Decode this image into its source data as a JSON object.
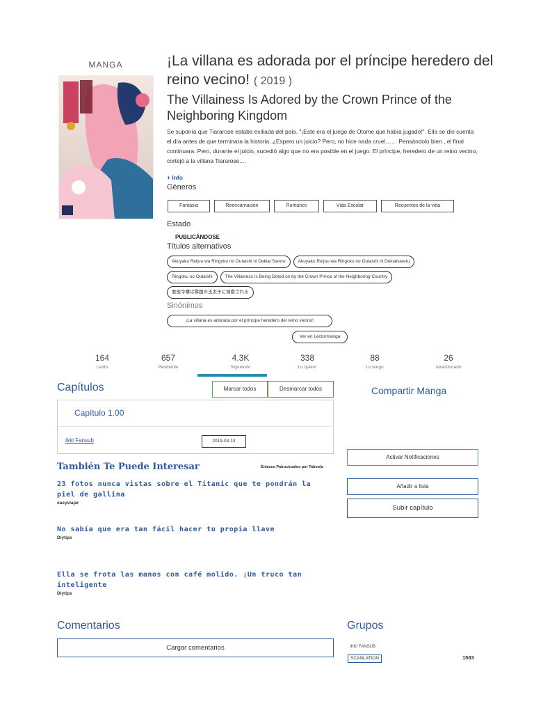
{
  "manga": {
    "type": "MANGA",
    "title": "¡La villana es adorada por el príncipe heredero del reino vecino!",
    "year": "( 2019 )",
    "subtitle": "The Villainess Is Adored by the Crown Prince of the Neighboring Kingdom",
    "synopsis": "Se suponía que Tiararose estaba exiliada del país. \"¡Este era el juego de Otome que había jugado!\". Ella se dio cuenta el día antes de que terminara la historia. ¿Espero un juicio? Pero, no hice nada cruel…… Pensándolo bien , el final continuara. Pero, durante el juicio, sucedió algo que no era posible en el juego. El príncipe, heredero de un reino vecino, cortejó a la villana Tiararose....",
    "more_info": "+ Info",
    "genres_label": "Géneros",
    "genres": [
      "Fantasia",
      "Reencarnación",
      "Romance",
      "Vida Escolar",
      "Recuentos de la vida"
    ],
    "status_label": "Estado",
    "status": "PUBLICÁNDOSE",
    "alt_titles_label": "Títulos alternativos",
    "alt_titles": [
      "Akuyaku Reijou wa Ringoku no Outaishi ni Dekiai Sareru",
      "Akuyaku Reijou wa Ringoku no Outaishi ni Dekiaisareru",
      "Ringoku no Outaishi",
      "The Villainess Is Being Doted on by the Crown Prince of the Neighboring Country",
      "悪役令嬢は隣国の王太子に溺愛される"
    ],
    "synonyms_label": "Sinónimos",
    "synonym": "¡La villana es adorada por el príncipe heredero del reino vecino!",
    "reader_link": "Ver en Lectormanga"
  },
  "stats": [
    {
      "value": "164",
      "label": "Leído"
    },
    {
      "value": "657",
      "label": "Pendiente"
    },
    {
      "value": "4.3K",
      "label": "Siguiendo"
    },
    {
      "value": "338",
      "label": "Lo quiero"
    },
    {
      "value": "88",
      "label": "Lo tengo"
    },
    {
      "value": "26",
      "label": "Abandonado"
    }
  ],
  "chapters": {
    "title": "Capítulos",
    "mark_all": "Marcar todos",
    "unmark_all": "Desmarcar todos",
    "items": [
      {
        "title": "Capítulo 1.00",
        "group": "Ikki Fansub",
        "date": "2019-03-14"
      }
    ]
  },
  "share": {
    "title": "Compartir Manga",
    "notifications": "Activar Notificaciones",
    "add_list": "Añadir a lista",
    "upload": "Subir capítulo"
  },
  "recommendations": {
    "title": "También Te Puede Interesar",
    "sponsor": "Enlaces Patrocinados por Taboola",
    "items": [
      {
        "title": "23 fotos nunca vistas sobre el Titanic que te pondrán la piel de gallina",
        "source": "easyviajar"
      },
      {
        "title": "No sabía que era tan fácil hacer tu propia llave",
        "source": "Diytips"
      },
      {
        "title": "Ella se frota las manos con café molido. ¡Un truco tan inteligente",
        "source": "Diytips"
      }
    ]
  },
  "comments": {
    "title": "Comentarios",
    "load": "Cargar comentarios"
  },
  "groups": {
    "title": "Grupos",
    "items": [
      {
        "name": "IKKI FANSUB",
        "badge": "SCANLATION",
        "count": "1583"
      }
    ]
  },
  "colors": {
    "accent_blue": "#2c5aa0",
    "green_border": "#4cae4c",
    "red_border": "#d9534f",
    "stat_underline": "#2a8cb2"
  }
}
